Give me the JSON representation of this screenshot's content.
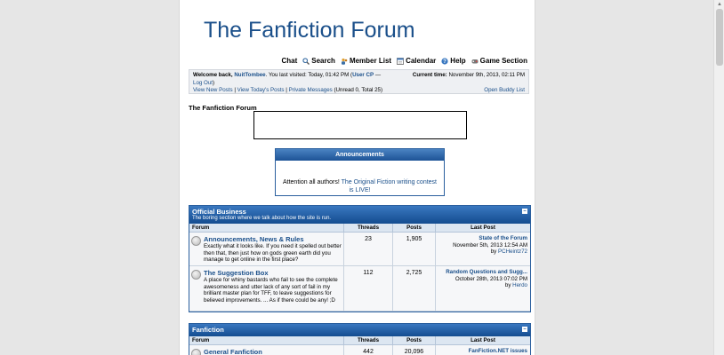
{
  "site": {
    "title": "The Fanfiction Forum"
  },
  "nav": [
    {
      "label": "Chat",
      "icon": ""
    },
    {
      "label": "Search",
      "icon": "search-icon"
    },
    {
      "label": "Member List",
      "icon": "member-list-icon"
    },
    {
      "label": "Calendar",
      "icon": "calendar-icon"
    },
    {
      "label": "Help",
      "icon": "help-icon"
    },
    {
      "label": "Game Section",
      "icon": "game-icon"
    }
  ],
  "welcome": {
    "prefix": "Welcome back,",
    "username": "NuitTombee",
    "last_visit": ". You last visited: Today, 01:42 PM (",
    "user_cp": "User CP",
    "dash": " — ",
    "current_time_label": "Current time:",
    "current_time": "November 9th, 2013, 02:11 PM",
    "logout": "Log Out",
    "logout_close": ")",
    "view_new_posts": "View New Posts",
    "sep1": " | ",
    "view_todays_posts": "View Today's Posts",
    "sep2": " | ",
    "private_messages": "Private Messages",
    "pm_counts": " (Unread 0, Total 25)",
    "open_buddy_list": "Open Buddy List"
  },
  "board_title": "The Fanfiction Forum",
  "announcements": {
    "header": "Announcements",
    "text": "Attention all authors! ",
    "link": "The Original Fiction writing contest is LIVE!"
  },
  "columns": {
    "forum": "Forum",
    "threads": "Threads",
    "posts": "Posts",
    "last_post": "Last Post"
  },
  "categories": [
    {
      "title": "Official Business",
      "description": "The boring section where we talk about how the site is run.",
      "forums": [
        {
          "name": "Announcements, News & Rules",
          "description": "Exactly what it looks like. If you need it spelled out better then that, then just how on gods green earth did you manage to get online in the first place?",
          "threads": "23",
          "posts": "1,905",
          "last_title": "State of the Forum",
          "last_date": "November 5th, 2013 12:54 AM",
          "last_by": "by ",
          "last_user": "PCHeintz72"
        },
        {
          "name": "The Suggestion Box",
          "description": "A place for whiny bastards who fail to see the complete awesomeness and utter lack of any sort of fail in my brilliant master plan for TFF, to leave suggestions for believed improvements. ... As if there could be any! ;D",
          "threads": "112",
          "posts": "2,725",
          "last_title": "Random Questions and Sugg...",
          "last_date": "October 28th, 2013 07:02 PM",
          "last_by": "by ",
          "last_user": "Herdo"
        }
      ]
    },
    {
      "title": "Fanfiction",
      "description": "",
      "forums": [
        {
          "name": "General Fanfiction",
          "description": "",
          "threads": "442",
          "posts": "20,096",
          "last_title": "FanFiction.NET issues",
          "last_date": "",
          "last_by": "",
          "last_user": ""
        }
      ]
    }
  ],
  "collapse_glyph": "–",
  "colors": {
    "brand": "#1a4f8a",
    "header_top": "#3a78c0",
    "header_bottom": "#134c90"
  }
}
